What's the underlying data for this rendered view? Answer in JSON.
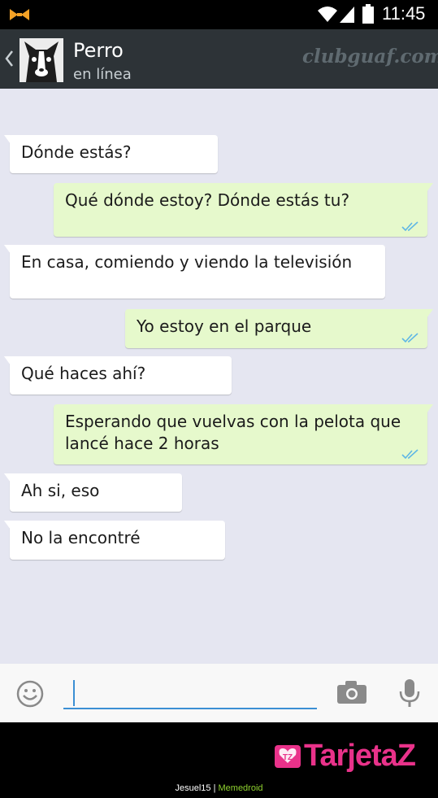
{
  "status_bar": {
    "time": "11:45",
    "icons": [
      "notification-icon",
      "wifi-icon",
      "signal-icon",
      "battery-icon"
    ]
  },
  "header": {
    "contact_name": "Perro",
    "contact_status": "en línea",
    "watermark": "clubguaf.com",
    "icons": [
      "back-icon",
      "avatar"
    ]
  },
  "messages": [
    {
      "direction": "in",
      "text": "Dónde estás?"
    },
    {
      "direction": "out",
      "text": "Qué dónde estoy? Dónde estás tu?",
      "read": true
    },
    {
      "direction": "in",
      "text": "En casa, comiendo y viendo la televisión"
    },
    {
      "direction": "out",
      "text": "Yo estoy en el parque",
      "read": true
    },
    {
      "direction": "in",
      "text": "Qué haces ahí?"
    },
    {
      "direction": "out",
      "text": "Esperando que vuelvas con la pelota que lancé hace 2 horas",
      "read": true
    },
    {
      "direction": "in",
      "text": "Ah si, eso"
    },
    {
      "direction": "in",
      "text": "No la encontré"
    }
  ],
  "input_bar": {
    "value": "",
    "icons": [
      "smiley-icon",
      "camera-icon",
      "mic-icon"
    ]
  },
  "footer": {
    "brand": "TarjetaZ",
    "brand_logo_text": "TZ",
    "credit_user": "Jesuel15",
    "credit_separator": "|",
    "credit_site": "Memedroid"
  },
  "colors": {
    "header_bg": "#2d3337",
    "chat_bg": "#e5e6f1",
    "incoming_bubble": "#ffffff",
    "outgoing_bubble": "#e6f9cc",
    "read_ticks": "#5fb7e5",
    "input_accent": "#3b8fd4",
    "brand": "#e9328a"
  }
}
